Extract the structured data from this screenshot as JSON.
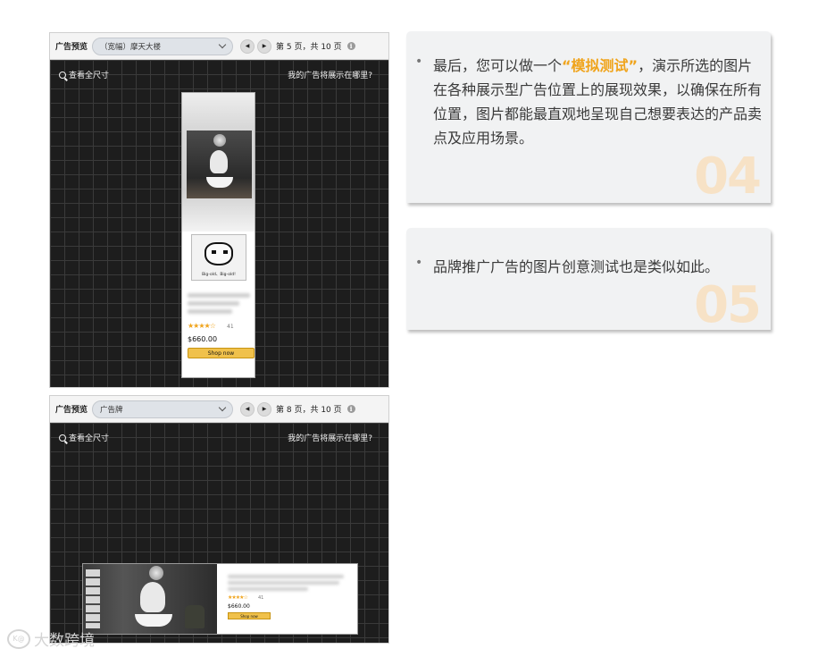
{
  "top_preview": {
    "toolbar": {
      "title": "广告预览",
      "selected_option": "（宽幅）摩天大楼",
      "prev_icon": "◀",
      "next_icon": "▶",
      "page_info": "第 5 页，共 10 页",
      "info_icon": "i"
    },
    "view_full_size": "查看全尺寸",
    "where_link": "我的广告将展示在哪里?",
    "ad": {
      "meme_caption": "Big-old、Big-old!",
      "rating": 4,
      "stars": "★★★★☆",
      "reviews": "41",
      "price": "$660.00",
      "button_label": "Shop now"
    }
  },
  "bottom_preview": {
    "toolbar": {
      "title": "广告预览",
      "selected_option": "广告牌",
      "prev_icon": "◀",
      "next_icon": "▶",
      "page_info": "第 8 页，共 10 页",
      "info_icon": "i"
    },
    "view_full_size": "查看全尺寸",
    "where_link": "我的广告将展示在哪里?",
    "ad": {
      "rating": 4,
      "stars": "★★★★☆",
      "reviews": "41",
      "price": "$660.00",
      "button_label": "Shop now"
    }
  },
  "cards": [
    {
      "bullet": "•",
      "text_before": "最后，您可以做一个",
      "highlight": "“模拟测试”",
      "text_after": "，演示所选的图片在各种展示型广告位置上的展现效果，以确保在所有位置，图片都能最直观地呈现自己想要表达的产品卖点及应用场景。",
      "number": "04"
    },
    {
      "bullet": "•",
      "text": "品牌推广广告的图片创意测试也是类似如此。",
      "number": "05"
    }
  ],
  "watermark": {
    "logo": "K@",
    "text": "大数跨境"
  },
  "colors": {
    "accent": "#f0a41c",
    "shop_button": "#f0c14b",
    "number_tint": "#f7e2c6",
    "grid_bg": "#1d1d1d",
    "card_bg": "#f1f2f3"
  }
}
